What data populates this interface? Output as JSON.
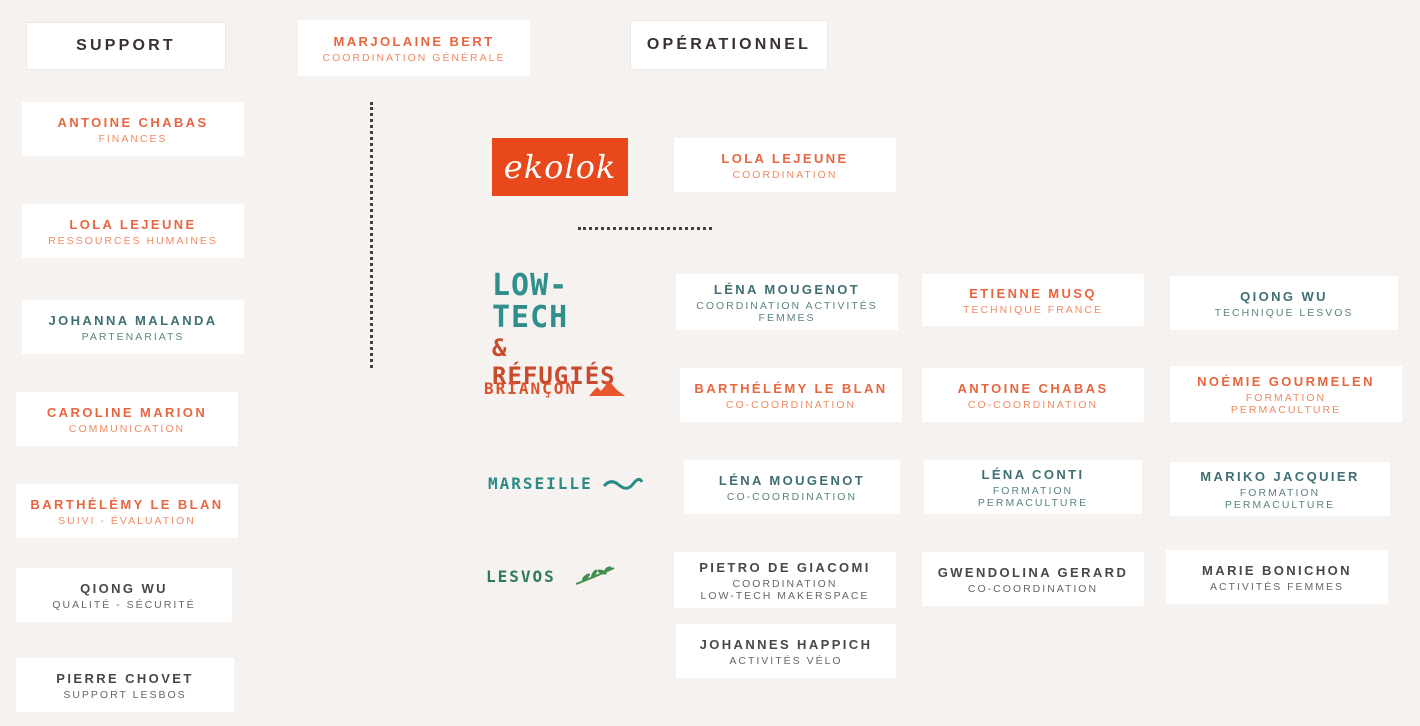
{
  "headers": {
    "support": "SUPPORT",
    "operationnel": "OPÉRATIONNEL"
  },
  "coordination_generale": {
    "name": "MARJOLAINE BERT",
    "role": "COORDINATION GÉNÉRALE"
  },
  "support": [
    {
      "name": "ANTOINE CHABAS",
      "role": "FINANCES"
    },
    {
      "name": "LOLA LEJEUNE",
      "role": "RESSOURCES HUMAINES"
    },
    {
      "name": "JOHANNA MALANDA",
      "role": "PARTENARIATS"
    },
    {
      "name": "CAROLINE MARION",
      "role": "COMMUNICATION"
    },
    {
      "name": "BARTHÉLÉMY LE BLAN",
      "role": "SUIVI - ÉVALUATION"
    },
    {
      "name": "QIONG WU",
      "role": "QUALITÉ - SÉCURITÉ"
    },
    {
      "name": "PIERRE CHOVET",
      "role": "SUPPORT LESBOS"
    }
  ],
  "logos": {
    "ekolok": "ekolok",
    "lowtech_line1": "LOW-TECH",
    "lowtech_line2": "& RÉFUGIÉS",
    "briancon": "BRIANÇON",
    "marseille": "MARSEILLE",
    "lesvos": "LESVOS"
  },
  "ekolok_coordination": {
    "name": "LOLA LEJEUNE",
    "role": "COORDINATION"
  },
  "lowtech": [
    {
      "name": "LÉNA MOUGENOT",
      "role": "COORDINATION ACTIVITÉS\nFEMMES"
    },
    {
      "name": "ETIENNE MUSQ",
      "role": "TECHNIQUE FRANCE"
    },
    {
      "name": "QIONG WU",
      "role": "TECHNIQUE LESVOS"
    }
  ],
  "briancon": [
    {
      "name": "BARTHÉLÉMY LE BLAN",
      "role": "CO-COORDINATION"
    },
    {
      "name": "ANTOINE CHABAS",
      "role": "CO-COORDINATION"
    },
    {
      "name": "NOÉMIE GOURMELEN",
      "role": "FORMATION\nPERMACULTURE"
    }
  ],
  "marseille": [
    {
      "name": "LÉNA MOUGENOT",
      "role": "CO-COORDINATION"
    },
    {
      "name": "LÉNA CONTI",
      "role": "FORMATION\nPERMACULTURE"
    },
    {
      "name": "MARIKO JACQUIER",
      "role": "FORMATION\nPERMACULTURE"
    }
  ],
  "lesvos": [
    {
      "name": "PIETRO DE GIACOMI",
      "role": "COORDINATION\nLOW-TECH MAKERSPACE"
    },
    {
      "name": "GWENDOLINA GERARD",
      "role": "CO-COORDINATION"
    },
    {
      "name": "MARIE BONICHON",
      "role": "ACTIVITÉS FEMMES"
    },
    {
      "name": "JOHANNES HAPPICH",
      "role": "ACTIVITÉS VÉLO"
    }
  ],
  "colors": {
    "orange": "#e8663f",
    "teal": "#3f6f72",
    "gray": "#474747",
    "ekolok_bg": "#e8481b",
    "background": "#f6f2f0"
  }
}
